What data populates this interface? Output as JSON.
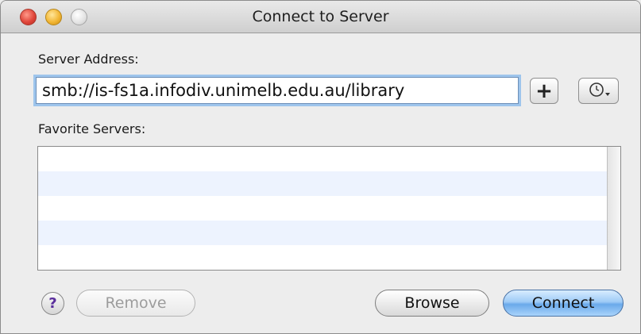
{
  "window": {
    "title": "Connect to Server"
  },
  "labels": {
    "server_address": "Server Address:",
    "favorite_servers": "Favorite Servers:"
  },
  "address_field": {
    "value": "smb://is-fs1a.infodiv.unimelb.edu.au/library"
  },
  "buttons": {
    "add_label": "+",
    "help_label": "?",
    "remove_label": "Remove",
    "browse_label": "Browse",
    "connect_label": "Connect"
  },
  "icons": {
    "add": "plus-icon",
    "recent": "clock-dropdown-icon",
    "help": "question-icon"
  },
  "colors": {
    "connect_accent": "#6aa9ea",
    "row_stripe": "#edf3fe",
    "help_glyph": "#5a2e9c"
  }
}
